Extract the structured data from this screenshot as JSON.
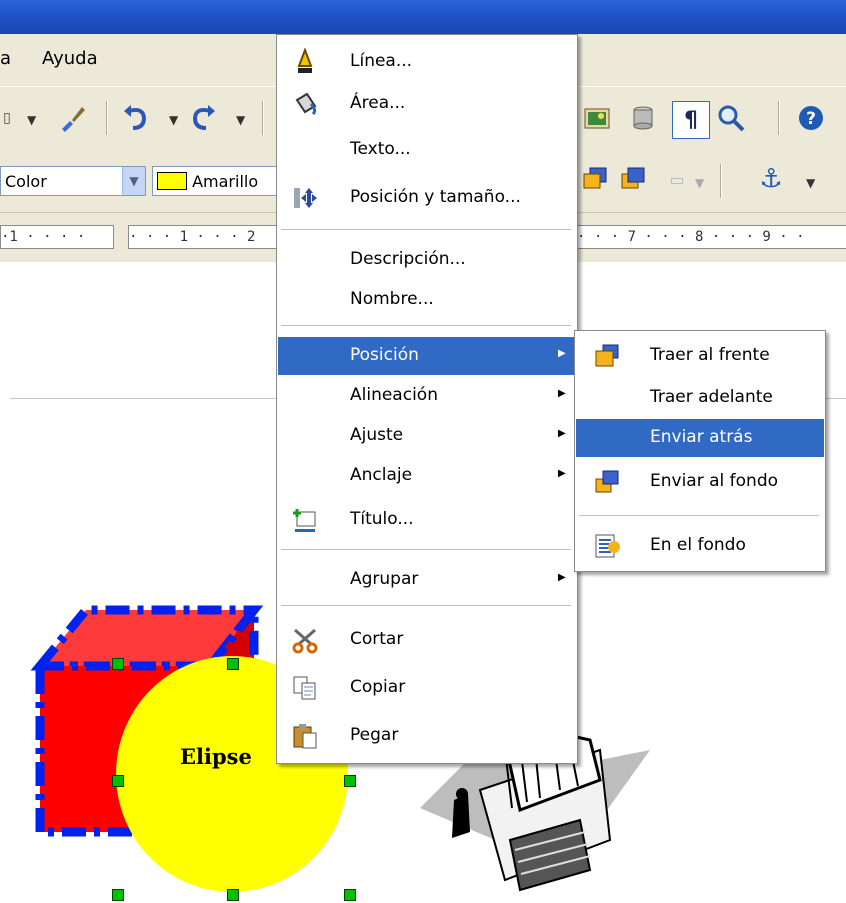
{
  "menubar": {
    "items": [
      "a",
      "Ayuda"
    ]
  },
  "toolbar": {
    "color_combo": "Color",
    "fill_combo": "Amarillo",
    "fill_color": "#ffff00"
  },
  "ruler": {
    "left_text": "·1 · · · ·",
    "mid_text": "· · · 1 · · · 2",
    "right_text": "· · · 7 · · · 8 · · · 9 · ·"
  },
  "context_menu": {
    "items": [
      {
        "label": "Línea...",
        "icon": "line-icon",
        "submenu": false
      },
      {
        "label": "Área...",
        "icon": "area-bucket-icon",
        "submenu": false
      },
      {
        "label": "Texto...",
        "icon": "",
        "submenu": false
      },
      {
        "label": "Posición y tamaño...",
        "icon": "position-size-icon",
        "submenu": false
      },
      {
        "label": "Descripción...",
        "icon": "",
        "submenu": false
      },
      {
        "label": "Nombre...",
        "icon": "",
        "submenu": false
      },
      {
        "label": "Posición",
        "icon": "",
        "submenu": true,
        "highlighted": true
      },
      {
        "label": "Alineación",
        "icon": "",
        "submenu": true
      },
      {
        "label": "Ajuste",
        "icon": "",
        "submenu": true
      },
      {
        "label": "Anclaje",
        "icon": "",
        "submenu": true
      },
      {
        "label": "Título...",
        "icon": "caption-icon",
        "submenu": false
      },
      {
        "label": "Agrupar",
        "icon": "",
        "submenu": true
      },
      {
        "label": "Cortar",
        "icon": "scissors-icon",
        "submenu": false
      },
      {
        "label": "Copiar",
        "icon": "copy-icon",
        "submenu": false
      },
      {
        "label": "Pegar",
        "icon": "paste-icon",
        "submenu": false
      }
    ]
  },
  "submenu": {
    "items": [
      {
        "label": "Traer al frente",
        "icon": "bring-to-front-icon"
      },
      {
        "label": "Traer adelante",
        "icon": ""
      },
      {
        "label": "Enviar atrás",
        "icon": "",
        "highlighted": true
      },
      {
        "label": "Enviar al fondo",
        "icon": "send-to-back-icon"
      },
      {
        "label": "En el fondo",
        "icon": "to-background-icon"
      }
    ]
  },
  "canvas": {
    "ellipse_label": "Elipse",
    "cube_color": "#ff0000",
    "cube_outline": "#0022ee",
    "ellipse_color": "#ffff00"
  },
  "colors": {
    "highlight": "#316ac5",
    "titlebar": "#1d4fc4",
    "chrome": "#ece9d8"
  }
}
